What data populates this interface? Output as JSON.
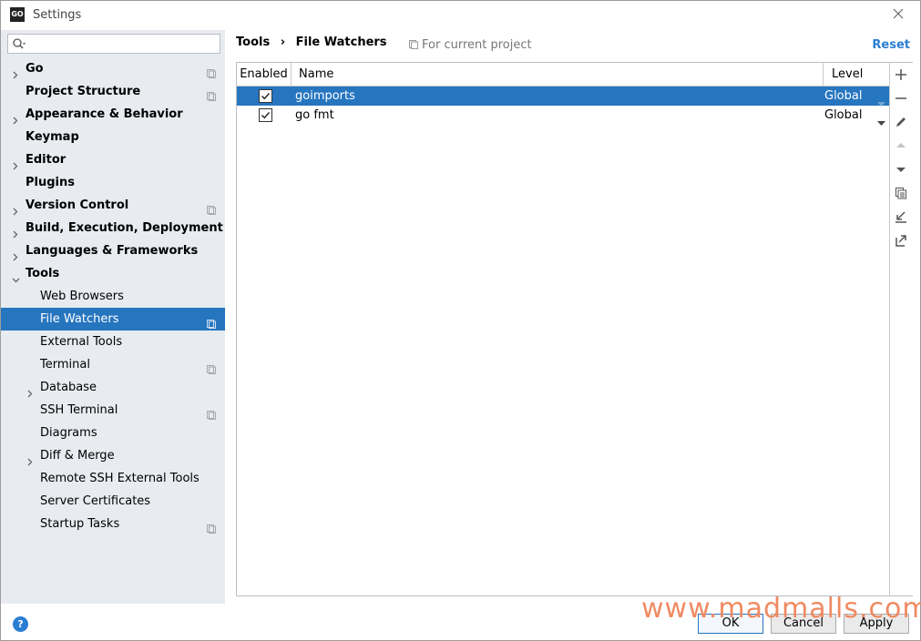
{
  "window": {
    "title": "Settings",
    "app_icon_text": "GO"
  },
  "search": {
    "placeholder": ""
  },
  "sidebar": {
    "items": [
      {
        "label": "Go",
        "bold": true,
        "arrow": "collapsed",
        "level": 0,
        "project_icon": true
      },
      {
        "label": "Project Structure",
        "bold": true,
        "arrow": "none",
        "level": 0,
        "project_icon": true
      },
      {
        "label": "Appearance & Behavior",
        "bold": true,
        "arrow": "collapsed",
        "level": 0,
        "project_icon": false
      },
      {
        "label": "Keymap",
        "bold": true,
        "arrow": "none",
        "level": 0,
        "project_icon": false
      },
      {
        "label": "Editor",
        "bold": true,
        "arrow": "collapsed",
        "level": 0,
        "project_icon": false
      },
      {
        "label": "Plugins",
        "bold": true,
        "arrow": "none",
        "level": 0,
        "project_icon": false
      },
      {
        "label": "Version Control",
        "bold": true,
        "arrow": "collapsed",
        "level": 0,
        "project_icon": true
      },
      {
        "label": "Build, Execution, Deployment",
        "bold": true,
        "arrow": "collapsed",
        "level": 0,
        "project_icon": false
      },
      {
        "label": "Languages & Frameworks",
        "bold": true,
        "arrow": "collapsed",
        "level": 0,
        "project_icon": false
      },
      {
        "label": "Tools",
        "bold": true,
        "arrow": "expanded",
        "level": 0,
        "project_icon": false
      },
      {
        "label": "Web Browsers",
        "bold": false,
        "arrow": "none",
        "level": 1,
        "project_icon": false
      },
      {
        "label": "File Watchers",
        "bold": false,
        "arrow": "none",
        "level": 1,
        "project_icon": true,
        "selected": true
      },
      {
        "label": "External Tools",
        "bold": false,
        "arrow": "none",
        "level": 1,
        "project_icon": false
      },
      {
        "label": "Terminal",
        "bold": false,
        "arrow": "none",
        "level": 1,
        "project_icon": true
      },
      {
        "label": "Database",
        "bold": false,
        "arrow": "collapsed",
        "level": 1,
        "project_icon": false
      },
      {
        "label": "SSH Terminal",
        "bold": false,
        "arrow": "none",
        "level": 1,
        "project_icon": true
      },
      {
        "label": "Diagrams",
        "bold": false,
        "arrow": "none",
        "level": 1,
        "project_icon": false
      },
      {
        "label": "Diff & Merge",
        "bold": false,
        "arrow": "collapsed",
        "level": 1,
        "project_icon": false
      },
      {
        "label": "Remote SSH External Tools",
        "bold": false,
        "arrow": "none",
        "level": 1,
        "project_icon": false
      },
      {
        "label": "Server Certificates",
        "bold": false,
        "arrow": "none",
        "level": 1,
        "project_icon": false
      },
      {
        "label": "Startup Tasks",
        "bold": false,
        "arrow": "none",
        "level": 1,
        "project_icon": true
      }
    ]
  },
  "breadcrumb": {
    "parent": "Tools",
    "separator": "›",
    "current": "File Watchers"
  },
  "scope_label": "For current project",
  "reset_label": "Reset",
  "table": {
    "columns": {
      "enabled": "Enabled",
      "name": "Name",
      "level": "Level"
    },
    "rows": [
      {
        "enabled": true,
        "name": "goimports",
        "level": "Global",
        "selected": true
      },
      {
        "enabled": true,
        "name": "go fmt",
        "level": "Global",
        "selected": false
      }
    ]
  },
  "toolbar": {
    "icons": [
      "add-icon",
      "remove-icon",
      "edit-icon",
      "move-up-icon",
      "move-down-icon",
      "copy-icon",
      "import-icon",
      "export-icon"
    ]
  },
  "buttons": {
    "ok": "OK",
    "cancel": "Cancel",
    "apply": "Apply"
  },
  "watermark": "www.madmalls.com",
  "colors": {
    "selection": "#2675bf",
    "link": "#2a7ed2",
    "sidebar_bg": "#e8ebf0",
    "watermark": "#f08a62"
  }
}
